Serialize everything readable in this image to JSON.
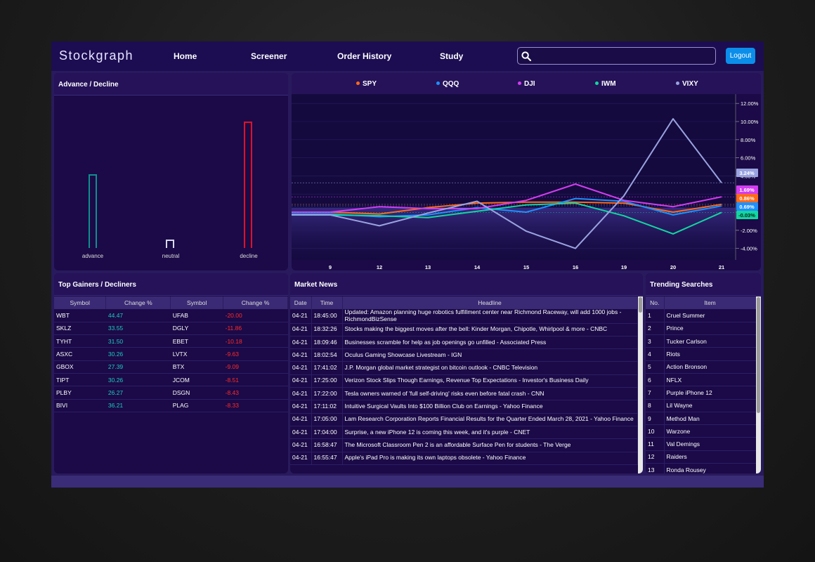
{
  "nav": {
    "brand": "Stockgraph",
    "links": [
      "Home",
      "Screener",
      "Order History",
      "Study"
    ],
    "search_placeholder": "",
    "logout_label": "Logout"
  },
  "advance_decline": {
    "title": "Advance / Decline",
    "bars": [
      {
        "label": "advance",
        "value": 105,
        "color": "#0f8f8f"
      },
      {
        "label": "neutral",
        "value": 12,
        "color": "#d8d8f0"
      },
      {
        "label": "decline",
        "value": 180,
        "color": "#e0102a"
      }
    ]
  },
  "chart_data": {
    "type": "line",
    "x": [
      "9",
      "12",
      "13",
      "14",
      "15",
      "16",
      "19",
      "20",
      "21"
    ],
    "ylim": [
      -5,
      12
    ],
    "yticks": [
      "12.00%",
      "10.00%",
      "8.00%",
      "6.00%",
      "4.00%",
      "2.00%",
      "0.00%",
      "-2.00%",
      "-4.00%"
    ],
    "series": [
      {
        "name": "SPY",
        "color": "#ff6a1a",
        "values": [
          0.0,
          -0.2,
          0.5,
          1.0,
          1.1,
          1.1,
          1.0,
          0.0,
          0.86
        ],
        "last": "0.86%"
      },
      {
        "name": "QQQ",
        "color": "#1e90ff",
        "values": [
          -0.2,
          -0.5,
          -0.3,
          0.5,
          0.0,
          1.5,
          1.2,
          -0.3,
          0.69
        ],
        "last": "0.69%"
      },
      {
        "name": "DJI",
        "color": "#d33cf0",
        "values": [
          0.0,
          0.6,
          0.4,
          0.4,
          1.3,
          3.1,
          1.3,
          0.6,
          1.69
        ],
        "last": "1.69%"
      },
      {
        "name": "IWM",
        "color": "#12d6a0",
        "values": [
          -0.3,
          -0.4,
          -0.6,
          0.1,
          0.8,
          1.0,
          -0.4,
          -2.4,
          -0.03
        ],
        "last": "-0.03%"
      },
      {
        "name": "VIXY",
        "color": "#9aa3e0",
        "values": [
          -0.3,
          -1.5,
          -0.1,
          1.2,
          -2.1,
          -4.0,
          1.8,
          10.3,
          3.24
        ],
        "last": "3.24%"
      }
    ]
  },
  "gainers": {
    "title": "Top Gainers / Decliners",
    "headers": [
      "Symbol",
      "Change %",
      "Symbol",
      "Change %"
    ],
    "rows": [
      [
        "WBT",
        "44.47",
        "UFAB",
        "-20.00"
      ],
      [
        "SKLZ",
        "33.55",
        "DGLY",
        "-11.86"
      ],
      [
        "TYHT",
        "31.50",
        "EBET",
        "-10.18"
      ],
      [
        "ASXC",
        "30.26",
        "LVTX",
        "-9.63"
      ],
      [
        "GBOX",
        "27.39",
        "BTX",
        "-9.09"
      ],
      [
        "TIPT",
        "30.26",
        "JCOM",
        "-8.51"
      ],
      [
        "PLBY",
        "26.27",
        "DSGN",
        "-8.43"
      ],
      [
        "BIVI",
        "36.21",
        "PLAG",
        "-8.33"
      ]
    ]
  },
  "news": {
    "title": "Market News",
    "headers": [
      "Date",
      "Time",
      "Headline"
    ],
    "rows": [
      [
        "04-21",
        "18:45:00",
        "Updated: Amazon planning huge robotics fulfillment center near Richmond Raceway, will add 1000 jobs - RichmondBizSense"
      ],
      [
        "04-21",
        "18:32:26",
        "Stocks making the biggest moves after the bell: Kinder Morgan, Chipotle, Whirlpool & more - CNBC"
      ],
      [
        "04-21",
        "18:09:46",
        "Businesses scramble for help as job openings go unfilled - Associated Press"
      ],
      [
        "04-21",
        "18:02:54",
        "Oculus Gaming Showcase Livestream - IGN"
      ],
      [
        "04-21",
        "17:41:02",
        "J.P. Morgan global market strategist on bitcoin outlook - CNBC Television"
      ],
      [
        "04-21",
        "17:25:00",
        "Verizon Stock Slips Though Earnings, Revenue Top Expectations - Investor's Business Daily"
      ],
      [
        "04-21",
        "17:22:00",
        "Tesla owners warned of 'full self-driving' risks even before fatal crash - CNN"
      ],
      [
        "04-21",
        "17:11:02",
        "Intuitive Surgical Vaults Into $100 Billion Club on Earnings - Yahoo Finance"
      ],
      [
        "04-21",
        "17:05:00",
        "Lam Research Corporation Reports Financial Results for the Quarter Ended March 28, 2021 - Yahoo Finance"
      ],
      [
        "04-21",
        "17:04:00",
        "Surprise, a new iPhone 12 is coming this week, and it's purple - CNET"
      ],
      [
        "04-21",
        "16:58:47",
        "The Microsoft Classroom Pen 2 is an affordable Surface Pen for students - The Verge"
      ],
      [
        "04-21",
        "16:55:47",
        "Apple's iPad Pro is making its own laptops obsolete - Yahoo Finance"
      ]
    ]
  },
  "trending": {
    "title": "Trending Searches",
    "headers": [
      "No.",
      "Item"
    ],
    "rows": [
      [
        "1",
        "Cruel Summer"
      ],
      [
        "2",
        "Prince"
      ],
      [
        "3",
        "Tucker Carlson"
      ],
      [
        "4",
        "Riots"
      ],
      [
        "5",
        "Action Bronson"
      ],
      [
        "6",
        "NFLX"
      ],
      [
        "7",
        "Purple iPhone 12"
      ],
      [
        "8",
        "Lil Wayne"
      ],
      [
        "9",
        "Method Man"
      ],
      [
        "10",
        "Warzone"
      ],
      [
        "11",
        "Val Demings"
      ],
      [
        "12",
        "Raiders"
      ],
      [
        "13",
        "Ronda Rousey"
      ]
    ]
  }
}
